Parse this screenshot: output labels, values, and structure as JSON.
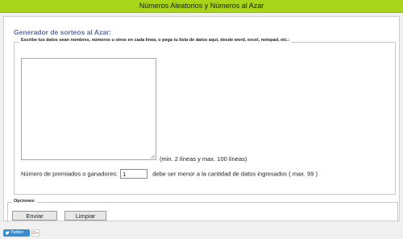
{
  "header": {
    "title": "Números Aleatorios y Números al Azar"
  },
  "form": {
    "title": "Generador de sorteos al Azar:",
    "data_legend": "Escribe tus datos sean nombres, números u otros en cada línea, o pega tu lista de datos aquí, desde word, excel, notepad, etc.:",
    "textarea_value": "",
    "lines_hint": "(min. 2 líneas y max. 100 líneas)",
    "winners_label": "Número de premiados o ganadores:",
    "winners_value": "1",
    "winners_hint": "debe ser menor a la cantidad de datos ingresados ( max. 99 )"
  },
  "options": {
    "legend": "Opciones:",
    "send_label": "Enviar",
    "clear_label": "Limpiar"
  },
  "social": {
    "twitter_label": "Twitter",
    "gplus_label": "G+"
  },
  "colors": {
    "topbar": "#a8d41a",
    "title": "#5b6fa6",
    "twitter": "#3a8bd0"
  }
}
